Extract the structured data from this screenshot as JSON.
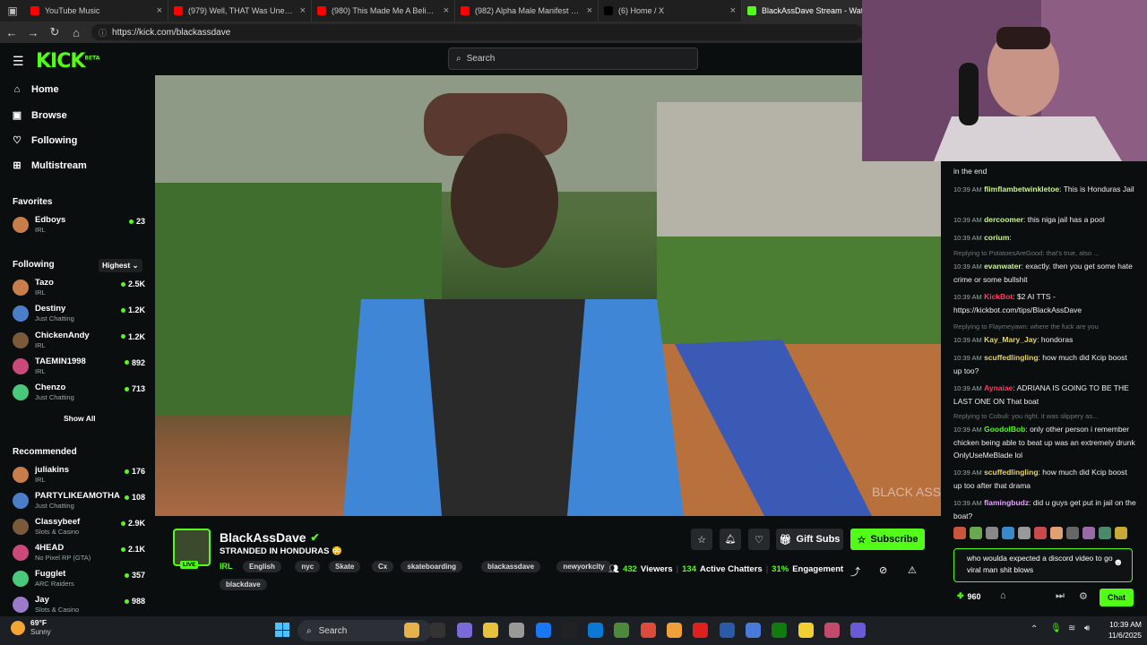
{
  "browser": {
    "tabs": [
      {
        "title": "YouTube Music",
        "color": "#ff0000"
      },
      {
        "title": "(979) Well, THAT Was Unexpected",
        "color": "#ff0000"
      },
      {
        "title": "(980) This Made Me A Believer in",
        "color": "#ff0000"
      },
      {
        "title": "(982) Alpha Male Manifest Guru",
        "color": "#ff0000"
      },
      {
        "title": "(6) Home / X",
        "color": "#000000"
      },
      {
        "title": "BlackAssDave Stream - Wat",
        "color": "#53fc18"
      }
    ],
    "url": "https://kick.com/blackassdave"
  },
  "header": {
    "logo": "KICK",
    "logo_sup": "BETA",
    "search_placeholder": "Search"
  },
  "sidebar": {
    "nav": [
      {
        "label": "Home",
        "icon": "home-icon"
      },
      {
        "label": "Browse",
        "icon": "browse-icon"
      },
      {
        "label": "Following",
        "icon": "heart-icon"
      },
      {
        "label": "Multistream",
        "icon": "grid-icon"
      }
    ],
    "favorites_title": "Favorites",
    "favorites": [
      {
        "name": "Edboys",
        "category": "IRL",
        "viewers": "23"
      }
    ],
    "following_title": "Following",
    "sort_label": "Highest",
    "following": [
      {
        "name": "Tazo",
        "category": "IRL",
        "viewers": "2.5K"
      },
      {
        "name": "Destiny",
        "category": "Just Chatting",
        "viewers": "1.2K"
      },
      {
        "name": "ChickenAndy",
        "category": "IRL",
        "viewers": "1.2K"
      },
      {
        "name": "TAEMIN1998",
        "category": "IRL",
        "viewers": "892"
      },
      {
        "name": "Chenzo",
        "category": "Just Chatting",
        "viewers": "713"
      }
    ],
    "show_all": "Show All",
    "recommended_title": "Recommended",
    "recommended": [
      {
        "name": "juliakins",
        "category": "IRL",
        "viewers": "176"
      },
      {
        "name": "PARTYLIKEAMOTHA",
        "category": "Just Chatting",
        "viewers": "108"
      },
      {
        "name": "Classybeef",
        "category": "Slots & Casino",
        "viewers": "2.9K"
      },
      {
        "name": "4HEAD",
        "category": "No Pixel RP (GTA)",
        "viewers": "2.1K"
      },
      {
        "name": "Fugglet",
        "category": "ARC Raiders",
        "viewers": "357"
      },
      {
        "name": "Jay",
        "category": "Slots & Casino",
        "viewers": "988"
      }
    ]
  },
  "stream": {
    "channel": "BlackAssDave",
    "title": "STRANDED IN HONDURAS 😳",
    "live_badge": "LIVE",
    "category": "IRL",
    "tags": [
      "English",
      "nyc",
      "Skate",
      "Cx",
      "skateboarding",
      "blackassdave",
      "newyorkcity",
      "blackdave"
    ],
    "gift_subs": "Gift Subs",
    "subscribe": "Subscribe",
    "viewers": "432",
    "viewers_label": "Viewers",
    "chatters": "134",
    "chatters_label": "Active Chatters",
    "engagement": "31%",
    "engagement_label": "Engagement",
    "watermark": "BLACK ASS DAVE"
  },
  "chat": {
    "messages": [
      {
        "type": "msg",
        "time": "",
        "user": "",
        "text": "in the end",
        "color": "#fff"
      },
      {
        "type": "msg",
        "time": "10:39 AM",
        "user": "flimflambetwinkletoe",
        "text": "This is Honduras Jail",
        "color": "#c9f58c"
      },
      {
        "type": "msg",
        "time": "10:39 AM",
        "user": "dercoomer",
        "text": "this niga jail has a pool",
        "color": "#c9f58c"
      },
      {
        "type": "msg",
        "time": "10:39 AM",
        "user": "corium",
        "text": "",
        "color": "#c9f58c"
      },
      {
        "type": "reply",
        "text": "Replying to PotatoesAreGood: that's true, also ..."
      },
      {
        "type": "msg",
        "time": "10:39 AM",
        "user": "evanwater",
        "text": "exactly. then you get some hate crime or some bullshit",
        "color": "#c9f58c"
      },
      {
        "type": "msg",
        "time": "10:39 AM",
        "user": "KickBot",
        "text": "$2 AI TTS - https://kickbot.com/tips/BlackAssDave",
        "color": "#ff3b5c"
      },
      {
        "type": "reply",
        "text": "Replying to Flaymeyawn: where the fuck are you"
      },
      {
        "type": "msg",
        "time": "10:39 AM",
        "user": "Kay_Mary_Jay",
        "text": "hondoras",
        "color": "#e6d36a"
      },
      {
        "type": "msg",
        "time": "10:39 AM",
        "user": "scuffedlingling",
        "text": "how much did Kcip boost up too?",
        "color": "#e6d36a"
      },
      {
        "type": "msg",
        "time": "10:39 AM",
        "user": "Aynaiae",
        "text": "ADRIANA IS GOING TO BE THE LAST ONE ON That boat",
        "color": "#ff3b5c"
      },
      {
        "type": "reply",
        "text": "Replying to Cobuli: you right. it was slippery as..."
      },
      {
        "type": "msg",
        "time": "10:39 AM",
        "user": "GoodolBob",
        "text": "only other person i remember chicken being able to beat up was an extremely drunk OnlyUseMeBlade lol",
        "color": "#53fc18"
      },
      {
        "type": "msg",
        "time": "10:39 AM",
        "user": "scuffedlingling",
        "text": "how much did Kcip boost up too after that drama",
        "color": "#e6d36a"
      },
      {
        "type": "msg",
        "time": "10:39 AM",
        "user": "flamingbudz",
        "text": "did u guys get put in jail on the boat?",
        "color": "#e6a0ff"
      }
    ],
    "input_text": "who woulda expected a discord video to go viral man shit blows",
    "points": "960",
    "chat_button": "Chat"
  },
  "taskbar": {
    "temperature": "69°F",
    "weather": "Sunny",
    "search": "Search",
    "time": "10:39 AM",
    "date": "11/6/2025"
  }
}
